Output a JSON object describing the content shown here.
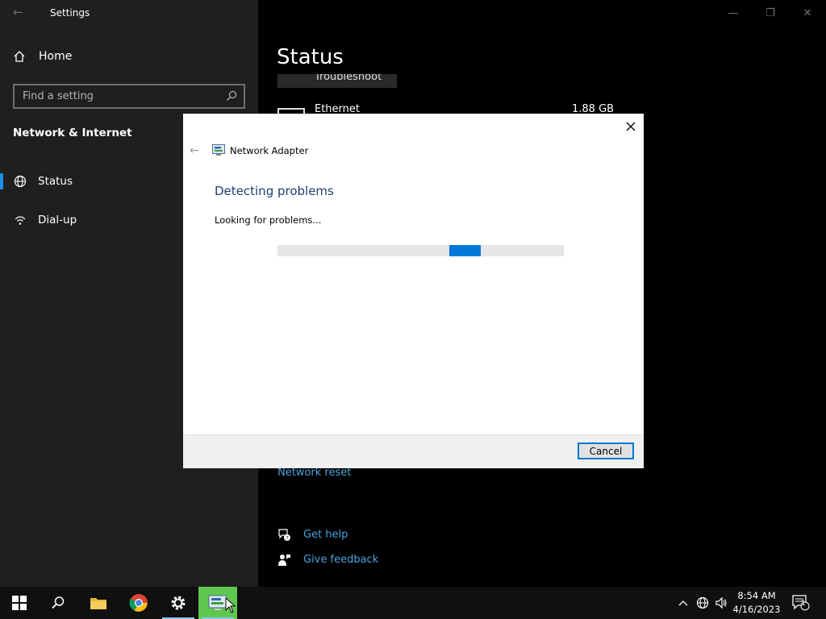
{
  "window": {
    "title": "Settings",
    "back_glyph": "←",
    "controls": {
      "minimize": "—",
      "maximize": "❐",
      "close": "✕"
    }
  },
  "sidebar": {
    "home_label": "Home",
    "search_placeholder": "Find a setting",
    "section_title": "Network & Internet",
    "items": [
      {
        "label": "Status",
        "icon": "globe-icon",
        "active": true
      },
      {
        "label": "Dial-up",
        "icon": "dialup-icon",
        "active": false
      }
    ]
  },
  "main": {
    "heading": "Status",
    "troubleshoot_label": "Troubleshoot",
    "ethernet": {
      "name": "Ethernet",
      "usage": "1.88 GB"
    },
    "network_reset": "Network reset",
    "get_help": "Get help",
    "give_feedback": "Give feedback"
  },
  "dialog": {
    "app_title": "Network Adapter",
    "heading": "Detecting problems",
    "status_text": "Looking for problems...",
    "progress": {
      "indeterminate": true,
      "chunk_start_fraction": 0.6,
      "chunk_width_fraction": 0.11
    },
    "cancel_label": "Cancel",
    "back_glyph": "←",
    "close_glyph": "✕"
  },
  "taskbar": {
    "time": "8:54 AM",
    "date": "4/16/2023",
    "notification_count": "1",
    "apps": [
      "start-icon",
      "search-icon",
      "file-explorer-icon",
      "chrome-icon",
      "settings-icon",
      "troubleshooter-icon"
    ]
  },
  "colors": {
    "accent": "#0078d7",
    "link": "#4aa3df",
    "dialog_heading": "#1e3f73",
    "highlight_app": "#5fc74f"
  }
}
